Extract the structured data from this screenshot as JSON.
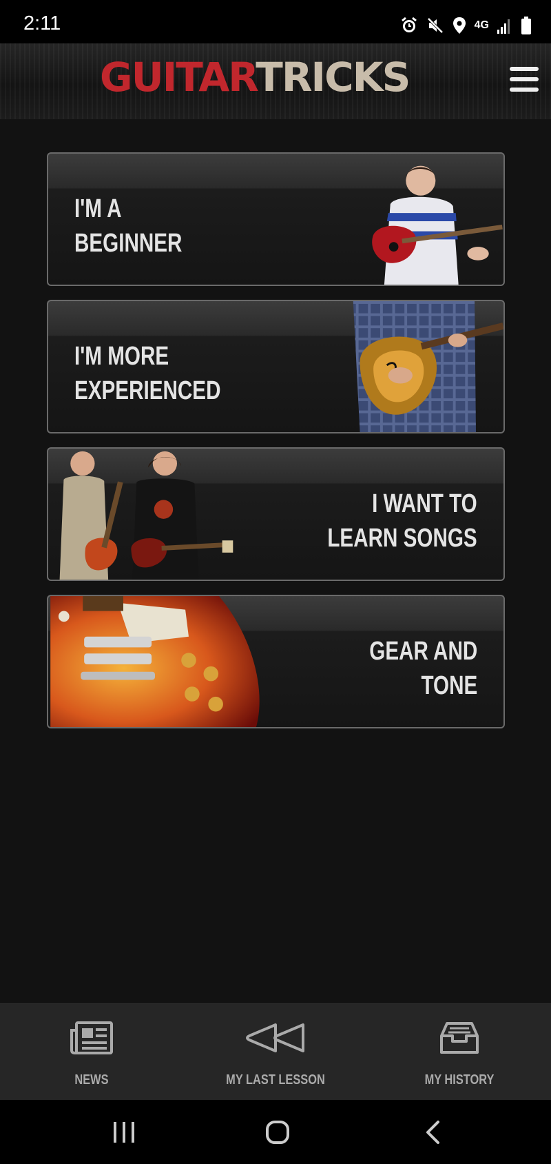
{
  "status_bar": {
    "time": "2:11",
    "network": "4G",
    "icons": [
      "alarm-icon",
      "mute-icon",
      "location-icon",
      "network-4g-icon",
      "signal-icon",
      "battery-icon"
    ]
  },
  "header": {
    "logo_part1": "GUITAR",
    "logo_part2": "TRICKS",
    "menu_icon": "hamburger-menu-icon"
  },
  "cards": [
    {
      "line1": "I'M A",
      "line2": "BEGINNER"
    },
    {
      "line1": "I'M MORE",
      "line2": "EXPERIENCED"
    },
    {
      "line1": "I WANT TO",
      "line2": "LEARN SONGS"
    },
    {
      "line1": "GEAR AND",
      "line2": "TONE"
    }
  ],
  "bottom_nav": [
    {
      "label": "NEWS",
      "icon": "newspaper-icon"
    },
    {
      "label": "MY LAST LESSON",
      "icon": "rewind-icon"
    },
    {
      "label": "MY HISTORY",
      "icon": "inbox-tray-icon"
    }
  ],
  "system_nav": [
    "recents-icon",
    "home-icon",
    "back-icon"
  ],
  "colors": {
    "logo_red": "#c1272d",
    "logo_beige": "#c8bcaa",
    "background": "#121212",
    "card_border": "#6a6a6a",
    "nav_background": "#262626"
  }
}
